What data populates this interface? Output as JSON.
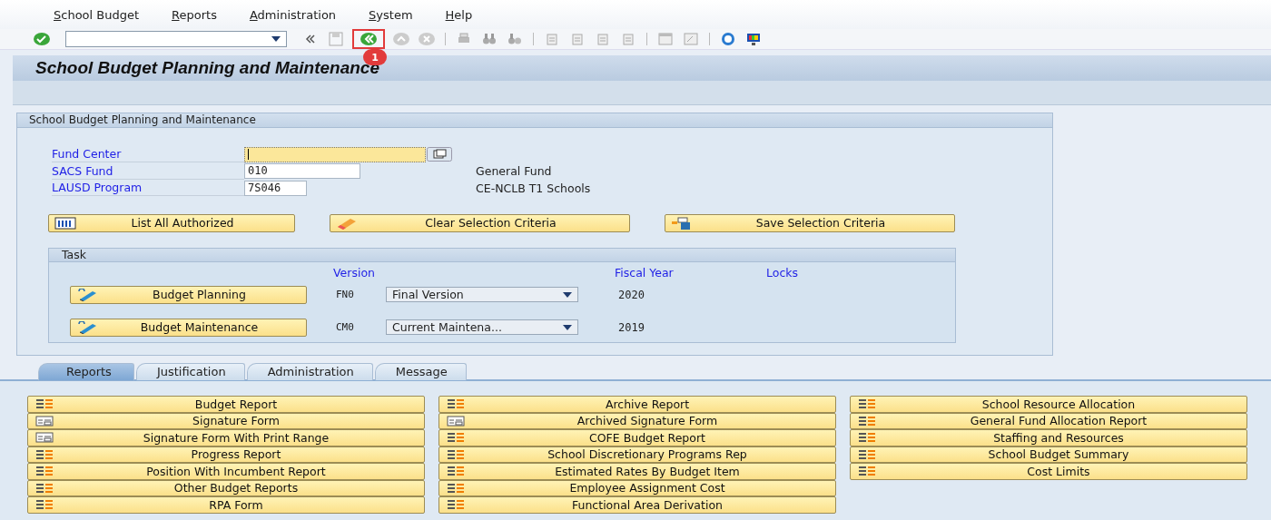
{
  "menu": [
    {
      "label": "School Budget"
    },
    {
      "label": "Reports"
    },
    {
      "label": "Administration"
    },
    {
      "label": "System"
    },
    {
      "label": "Help"
    }
  ],
  "toolbar": {
    "callout": "1"
  },
  "title": "School Budget Planning and Maintenance",
  "group": {
    "title": "School Budget Planning and Maintenance",
    "fields": [
      {
        "label": "Fund Center",
        "focused": true,
        "kind": "f4"
      },
      {
        "label": "SACS Fund",
        "value": "010",
        "focused": false,
        "description": "General Fund",
        "kind": "wide"
      },
      {
        "label": "LAUSD Program",
        "value": "7S046",
        "focused": false,
        "description": "CE-NCLB T1 Schools",
        "kind": "narrow"
      }
    ],
    "buttons": [
      {
        "label": "List All Authorized",
        "kind": "list"
      },
      {
        "label": "Clear Selection Criteria",
        "kind": "clear"
      },
      {
        "label": "Save Selection Criteria",
        "kind": "save"
      }
    ],
    "task": {
      "title": "Task",
      "headers": [
        "Version",
        "Fiscal Year",
        "Locks"
      ],
      "rows": [
        {
          "button": "Budget Planning",
          "code": "FN0",
          "version": "Final Version",
          "year": "2020"
        },
        {
          "button": "Budget Maintenance",
          "code": "CM0",
          "version": "Current Maintena...",
          "year": "2019"
        }
      ]
    }
  },
  "tabs": [
    {
      "label": "Reports",
      "selected": true
    },
    {
      "label": "Justification",
      "selected": false
    },
    {
      "label": "Administration",
      "selected": false
    },
    {
      "label": "Message",
      "selected": false
    }
  ],
  "report_columns": [
    [
      {
        "label": "Budget Report",
        "kind": "report"
      },
      {
        "label": "Signature Form",
        "kind": "form"
      },
      {
        "label": "Signature Form With Print Range",
        "kind": "form"
      },
      {
        "label": "Progress Report",
        "kind": "report"
      },
      {
        "label": "Position With Incumbent Report",
        "kind": "report"
      },
      {
        "label": "Other Budget Reports",
        "kind": "report"
      },
      {
        "label": "RPA Form",
        "kind": "report"
      }
    ],
    [
      {
        "label": "Archive Report",
        "kind": "report"
      },
      {
        "label": "Archived Signature Form",
        "kind": "form"
      },
      {
        "label": "COFE Budget Report",
        "kind": "report"
      },
      {
        "label": "School Discretionary Programs Rep",
        "kind": "report"
      },
      {
        "label": "Estimated Rates By Budget Item",
        "kind": "report"
      },
      {
        "label": "Employee Assignment Cost",
        "kind": "report"
      },
      {
        "label": "Functional Area Derivation",
        "kind": "report"
      }
    ],
    [
      {
        "label": "School Resource Allocation",
        "kind": "report"
      },
      {
        "label": "General Fund Allocation Report",
        "kind": "report"
      },
      {
        "label": "Staffing and Resources",
        "kind": "report"
      },
      {
        "label": "School Budget Summary",
        "kind": "report"
      },
      {
        "label": "Cost Limits",
        "kind": "report"
      }
    ]
  ]
}
